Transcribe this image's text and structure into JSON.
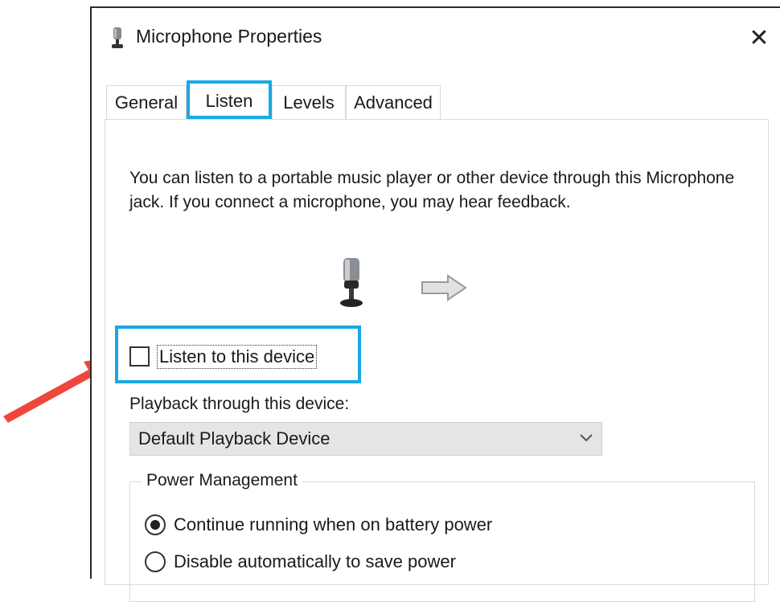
{
  "window": {
    "title": "Microphone Properties",
    "title_icon": "microphone-icon",
    "close_icon": "close-icon",
    "close_glyph": "✕"
  },
  "tabs": [
    {
      "label": "General",
      "active": false
    },
    {
      "label": "Listen",
      "active": true
    },
    {
      "label": "Levels",
      "active": false
    },
    {
      "label": "Advanced",
      "active": false
    }
  ],
  "listen": {
    "description": "You can listen to a portable music player or other device through this Microphone  jack.  If you connect a microphone, you may hear feedback.",
    "device_icon": "microphone-icon",
    "flow_icon": "arrow-right-icon",
    "checkbox_label": "Listen to this device",
    "checkbox_checked": false,
    "playback_label": "Playback through this device:",
    "playback_selected": "Default Playback Device",
    "power_group_title": "Power Management",
    "power_options": [
      {
        "label": "Continue running when on battery power",
        "selected": true
      },
      {
        "label": "Disable automatically to save power",
        "selected": false
      }
    ]
  },
  "colors": {
    "highlight": "#19a9e4",
    "annotation_arrow": "#f0473c",
    "dropdown_bg": "#e5e5e5"
  }
}
